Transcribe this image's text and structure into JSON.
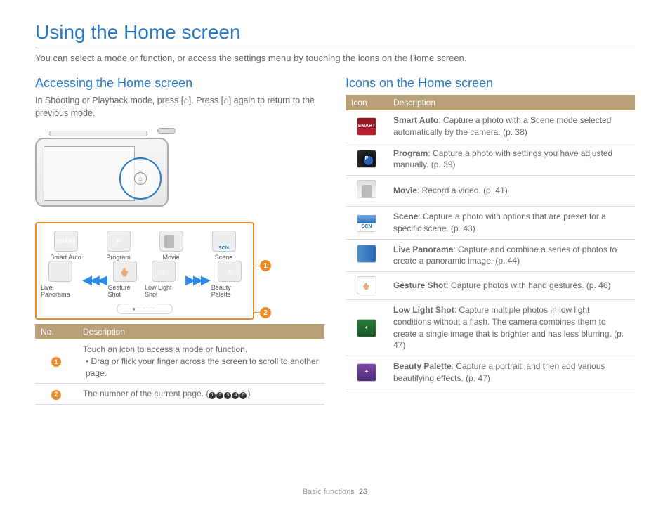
{
  "page": {
    "title": "Using the Home screen",
    "intro": "You can select a mode or function, or access the settings menu by touching the icons on the Home screen.",
    "footer_section": "Basic functions",
    "footer_page": "26"
  },
  "left": {
    "heading": "Accessing the Home screen",
    "subtext_a": "In Shooting or Playback mode, press [",
    "subtext_b": "]. Press [",
    "subtext_c": "] again to return to the previous mode.",
    "icons": {
      "smart": "Smart Auto",
      "program": "Program",
      "movie": "Movie",
      "scene": "Scene",
      "pano": "Live Panorama",
      "gesture": "Gesture Shot",
      "lowlight": "Low Light Shot",
      "beauty": "Beauty Palette"
    },
    "table": {
      "h1": "No.",
      "h2": "Description",
      "r1a": "Touch an icon to access a mode or function.",
      "r1b": "Drag or flick your finger across the screen to scroll to another page.",
      "r2": "The number of the current page. ("
    }
  },
  "right": {
    "heading": "Icons on the Home screen",
    "h1": "Icon",
    "h2": "Description",
    "rows": {
      "smart": {
        "b": "Smart Auto",
        "t": ": Capture a photo with a Scene mode selected automatically by the camera. (p. 38)"
      },
      "program": {
        "b": "Program",
        "t": ": Capture a photo with settings you have adjusted manually. (p. 39)"
      },
      "movie": {
        "b": "Movie",
        "t": ": Record a video. (p. 41)"
      },
      "scene": {
        "b": "Scene",
        "t": ": Capture a photo with options that are preset for a specific scene. (p. 43)"
      },
      "pano": {
        "b": "Live Panorama",
        "t": ": Capture and combine a series of photos to create a panoramic image. (p. 44)"
      },
      "gesture": {
        "b": "Gesture Shot",
        "t": ": Capture photos with hand gestures. (p. 46)"
      },
      "lowlight": {
        "b": "Low Light Shot",
        "t": ": Capture multiple photos in low light conditions without a flash. The camera combines them to create a single image that is brighter and has less blurring. (p. 47)"
      },
      "beauty": {
        "b": "Beauty Palette",
        "t": ": Capture a portrait, and then add various beautifying effects. (p. 47)"
      }
    }
  }
}
